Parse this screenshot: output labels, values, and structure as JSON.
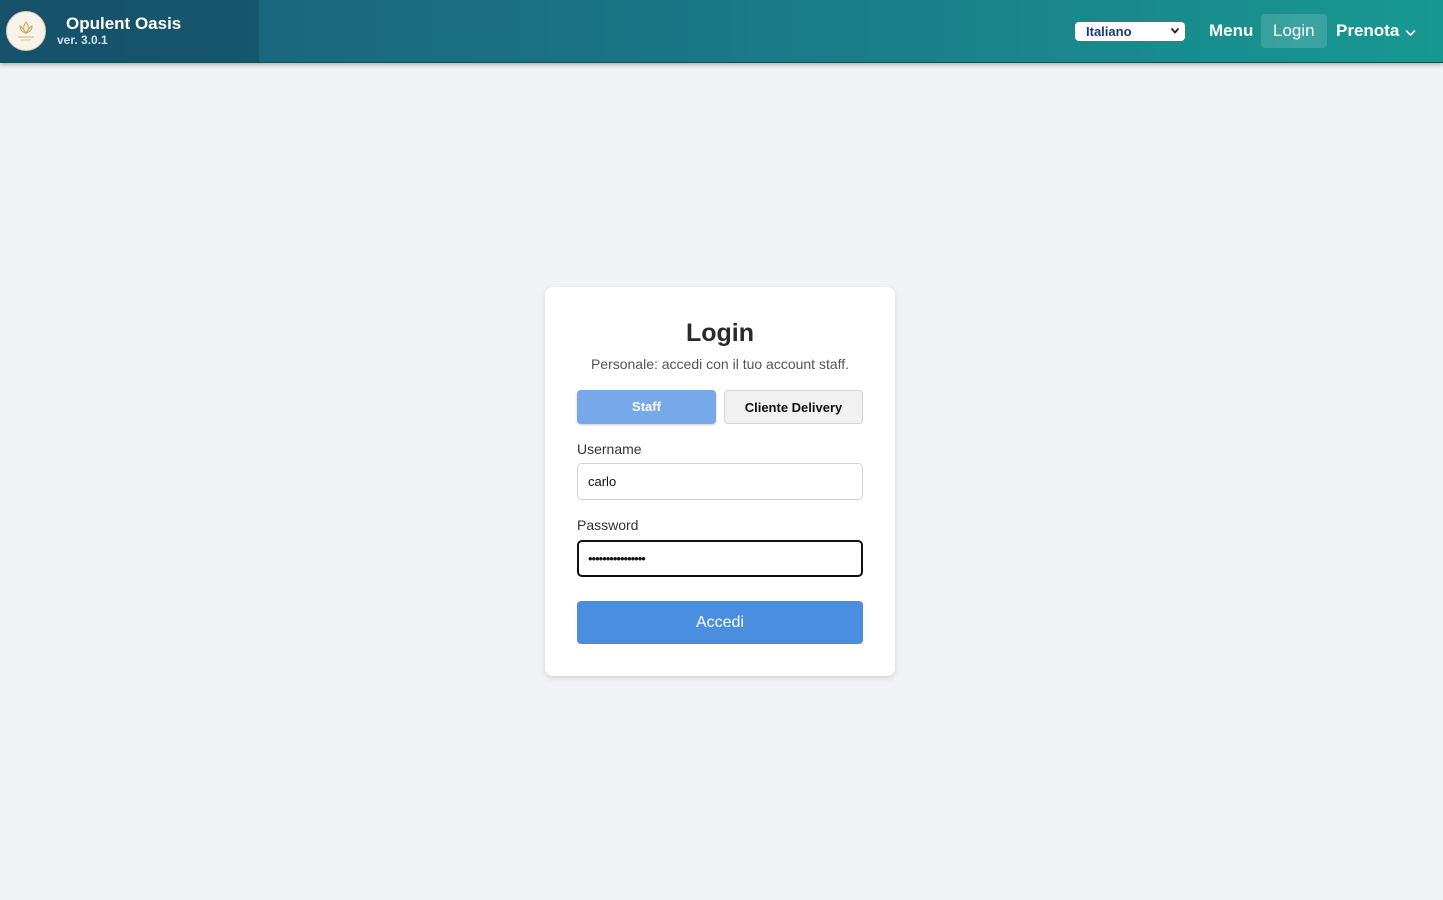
{
  "header": {
    "brand_name": "Opulent Oasis",
    "version": "ver. 3.0.1",
    "language_selected": "Italiano",
    "nav": {
      "menu_label": "Menu",
      "login_label": "Login",
      "prenota_label": "Prenota"
    }
  },
  "login": {
    "title": "Login",
    "subtitle": "Personale: accedi con il tuo account staff.",
    "tabs": {
      "staff_label": "Staff",
      "delivery_label": "Cliente Delivery"
    },
    "username_label": "Username",
    "username_value": "carlo",
    "password_label": "Password",
    "password_masked": "••••••••••••••••",
    "submit_label": "Accedi"
  },
  "colors": {
    "header_start": "#1a5e79",
    "header_end": "#189891",
    "primary_button": "#4a8ee0",
    "active_tab": "#77a8ea",
    "page_background": "#f0f2f6"
  },
  "icons": {
    "logo": "brand-logo",
    "language_chevron": "chevron-down-icon",
    "prenota_chevron": "chevron-down-icon"
  }
}
